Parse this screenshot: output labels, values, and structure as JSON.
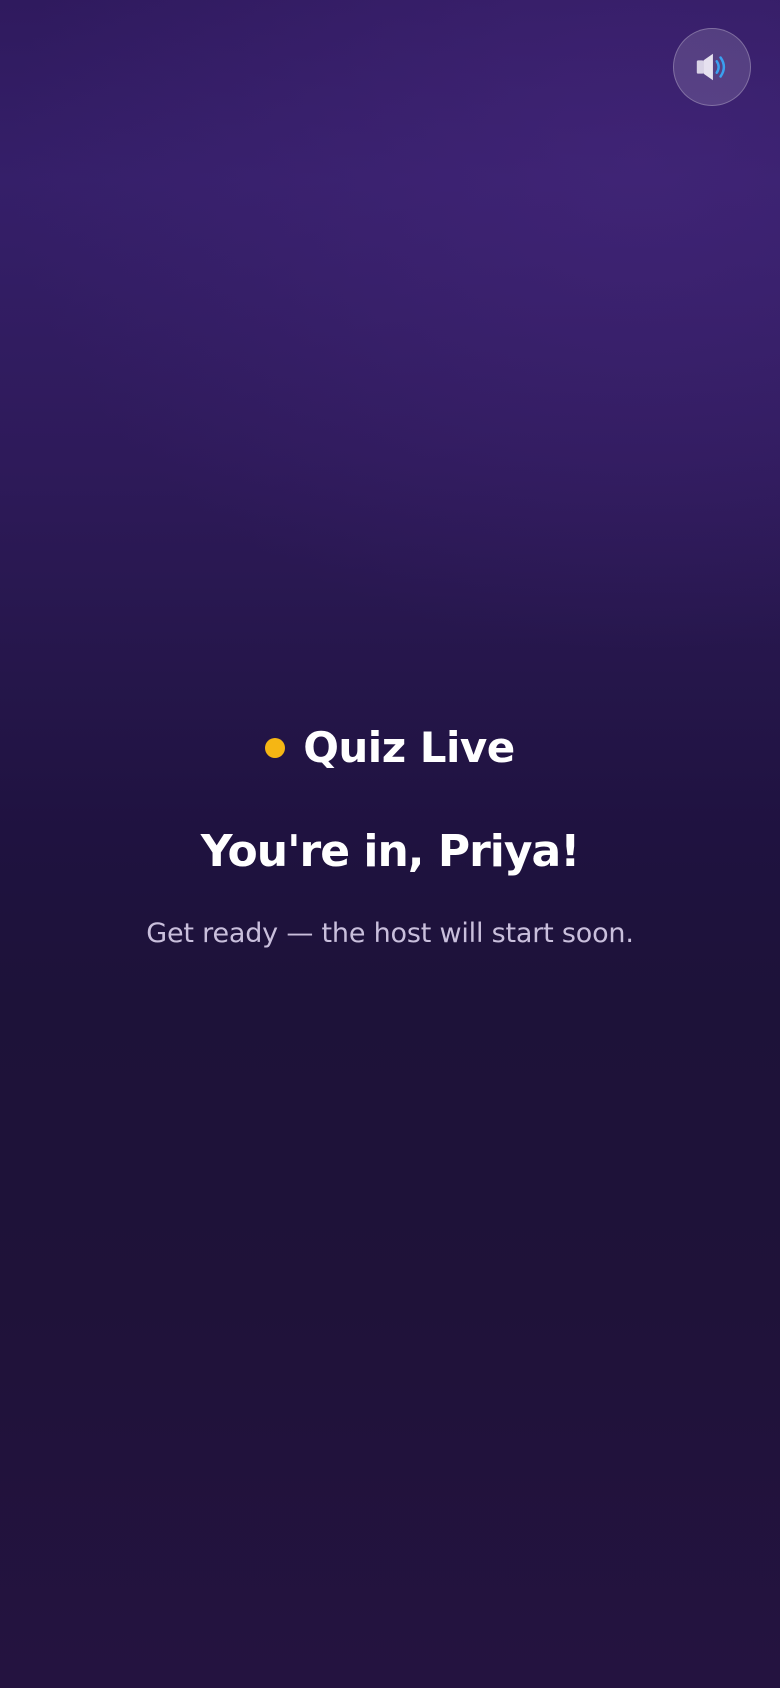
{
  "sound_toggle": {
    "icon": "speaker-volume-icon",
    "state": "on"
  },
  "status": {
    "label": "Quiz Live",
    "dot_color": "#f5b614"
  },
  "lobby": {
    "greeting": "You're in, Priya!",
    "message": "Get ready — the host will start soon."
  },
  "colors": {
    "background_top": "#351f69",
    "background_bottom": "#1e1239",
    "text": "#ffffff",
    "muted_text": "#c9bfdc",
    "speaker_waves": "#3aa0f0"
  }
}
